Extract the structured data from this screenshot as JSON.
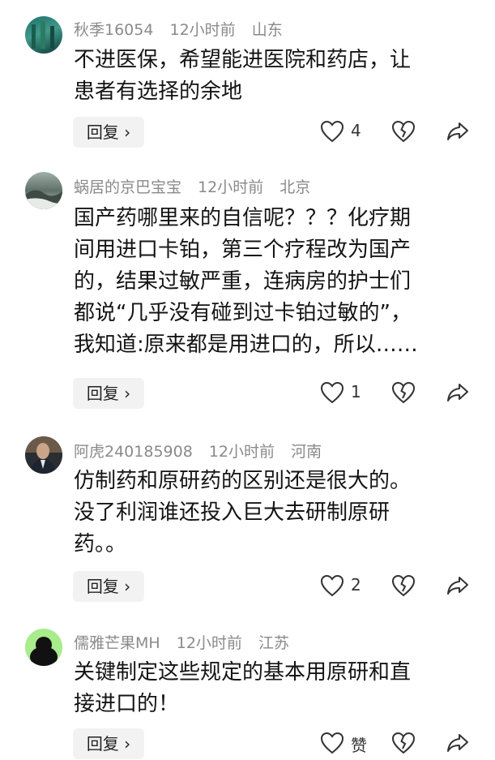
{
  "comments": [
    {
      "username": "秋季16054",
      "time": "12小时前",
      "location": "山东",
      "lines": [
        "不进医保，希望能进医院和药店，让",
        "患者有选择的余地"
      ],
      "reply_label": "回复 ›",
      "likes": "4"
    },
    {
      "username": "蜗居的京巴宝宝",
      "time": "12小时前",
      "location": "北京",
      "lines": [
        "国产药哪里来的自信呢？？？化疗期",
        "间用进口卡铂，第三个疗程改为国产",
        "的，结果过敏严重，连病房的护士们",
        "都说“几乎没有碰到过卡铂过敏的”，",
        "我知道:原来都是用进口的，所以……"
      ],
      "reply_label": "回复 ›",
      "likes": "1"
    },
    {
      "username": "阿虎240185908",
      "time": "12小时前",
      "location": "河南",
      "lines": [
        "仿制药和原研药的区别还是很大的。",
        "没了利润谁还投入巨大去研制原研",
        "药。。"
      ],
      "reply_label": "回复 ›",
      "likes": "2"
    },
    {
      "username": "儒雅芒果MH",
      "time": "12小时前",
      "location": "江苏",
      "lines": [
        "关键制定这些规定的基本用原研和直",
        "接进口的！"
      ],
      "reply_label": "回复 ›",
      "likes": "赞"
    }
  ],
  "icons": {
    "like": "heart-icon",
    "dislike": "broken-heart-icon",
    "share": "share-arrow-icon"
  }
}
